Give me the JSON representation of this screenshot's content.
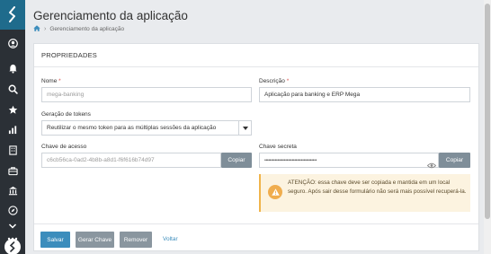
{
  "header": {
    "title": "Gerenciamento da aplicação",
    "breadcrumb": {
      "home_icon": "home-icon",
      "current": "Gerenciamento da aplicação"
    }
  },
  "panel": {
    "title": "PROPRIEDADES",
    "name_label": "Nome",
    "name_value": "mega-banking",
    "description_label": "Descrição",
    "description_value": "Aplicação para banking e ERP Mega",
    "required_mark": "*",
    "token_label": "Geração de tokens",
    "token_value": "Reutilizar o mesmo token para as múltiplas sessões da aplicação",
    "access_key_label": "Chave de acesso",
    "access_key_value": "c6cb56ca-0ad2-4b8b-a8d1-f6f616b74d97",
    "secret_key_label": "Chave secreta",
    "secret_key_value": "••••••••••••••••••••••••••••••••••••••••",
    "copy_label": "Copiar",
    "alert_text": "ATENÇÃO: essa chave deve ser copiada e mantida em um local seguro. Após sair desse formulário não será mais possível recuperá-la."
  },
  "actions": {
    "save": "Salvar",
    "generate": "Gerar Chave",
    "remove": "Remover",
    "back": "Voltar"
  },
  "colors": {
    "primary": "#3c8dbc",
    "sidebar": "#2b3036",
    "logo_bg": "#1f6b8c",
    "warning": "#f0ad4e",
    "secondary_button": "#8a969f"
  },
  "sidebar_icons": [
    "logo-icon",
    "user-circle-icon",
    "bell-icon",
    "search-icon",
    "star-icon",
    "chart-icon",
    "building-icon",
    "briefcase-icon",
    "bank-icon",
    "compass-icon",
    "chevron-down-icon",
    "more-icon"
  ]
}
